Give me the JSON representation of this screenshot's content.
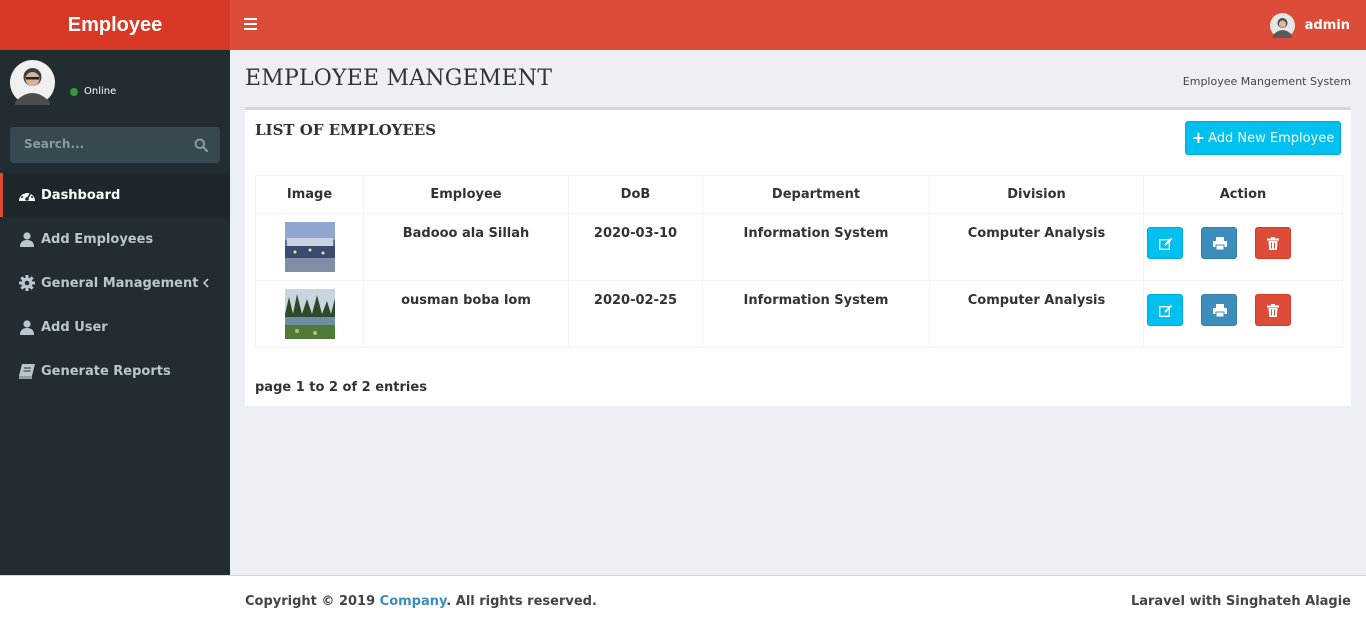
{
  "brand": "Employee",
  "topbar": {
    "username": "admin"
  },
  "sidebar": {
    "status": "Online",
    "search_placeholder": "Search...",
    "items": [
      {
        "label": "Dashboard",
        "icon": "dashboard-icon",
        "active": true
      },
      {
        "label": "Add Employees",
        "icon": "user-icon"
      },
      {
        "label": "General Management",
        "icon": "gear-icon"
      },
      {
        "label": "Add User",
        "icon": "user-icon"
      },
      {
        "label": "Generate Reports",
        "icon": "book-icon"
      }
    ]
  },
  "page": {
    "title": "EMPLOYEE MANGEMENT",
    "breadcrumb": "Employee Mangement System"
  },
  "box": {
    "title": "LIST OF EMPLOYEES",
    "add_button": "Add New Employee"
  },
  "table": {
    "headers": [
      "Image",
      "Employee",
      "DoB",
      "Department",
      "Division",
      "Action"
    ],
    "rows": [
      {
        "employee": "Badooo ala Sillah",
        "dob": "2020-03-10",
        "department": "Information System",
        "division": "Computer Analysis"
      },
      {
        "employee": "ousman boba lom",
        "dob": "2020-02-25",
        "department": "Information System",
        "division": "Computer Analysis"
      }
    ]
  },
  "pagination": {
    "text": "page 1 to 2 of 2 entries"
  },
  "footer": {
    "copyright_prefix": "Copyright © 2019 ",
    "company": "Company",
    "copyright_suffix": ". All rights reserved.",
    "credit": "Laravel with Singhateh Alagie"
  },
  "colors": {
    "header": "#dd4b39",
    "logo": "#d73925",
    "sidebar": "#222d32",
    "info": "#00c0ef",
    "primary": "#3c8dbc",
    "danger": "#dd4b39"
  }
}
